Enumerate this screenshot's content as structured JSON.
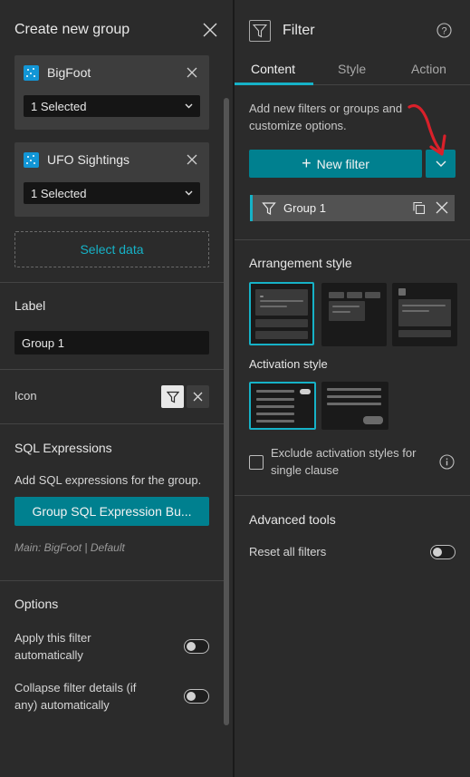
{
  "left_panel": {
    "title": "Create new group",
    "data_sources": [
      {
        "name": "BigFoot",
        "selection": "1 Selected"
      },
      {
        "name": "UFO Sightings",
        "selection": "1 Selected"
      }
    ],
    "select_data_label": "Select data",
    "label_section": {
      "title": "Label",
      "value": "Group 1"
    },
    "icon_section": {
      "title": "Icon"
    },
    "sql_section": {
      "title": "SQL Expressions",
      "description": "Add SQL expressions for the group.",
      "button_label": "Group SQL Expression Bu...",
      "main_text": "Main: BigFoot | Default"
    },
    "options_section": {
      "title": "Options",
      "apply_automatically": "Apply this filter automatically",
      "collapse_details": "Collapse filter details (if any) automatically"
    }
  },
  "right_panel": {
    "title": "Filter",
    "tabs": [
      {
        "label": "Content",
        "active": true
      },
      {
        "label": "Style",
        "active": false
      },
      {
        "label": "Action",
        "active": false
      }
    ],
    "description": "Add new filters or groups and customize options.",
    "new_filter_label": "New filter",
    "group_item": {
      "label": "Group 1"
    },
    "arrangement_title": "Arrangement style",
    "activation_title": "Activation style",
    "exclude_label": "Exclude activation styles for single clause",
    "advanced_title": "Advanced tools",
    "reset_label": "Reset all filters"
  },
  "colors": {
    "accent": "#16b2c7",
    "button": "#00808f",
    "panel": "#2b2b2b",
    "annotation": "#d9202a"
  }
}
